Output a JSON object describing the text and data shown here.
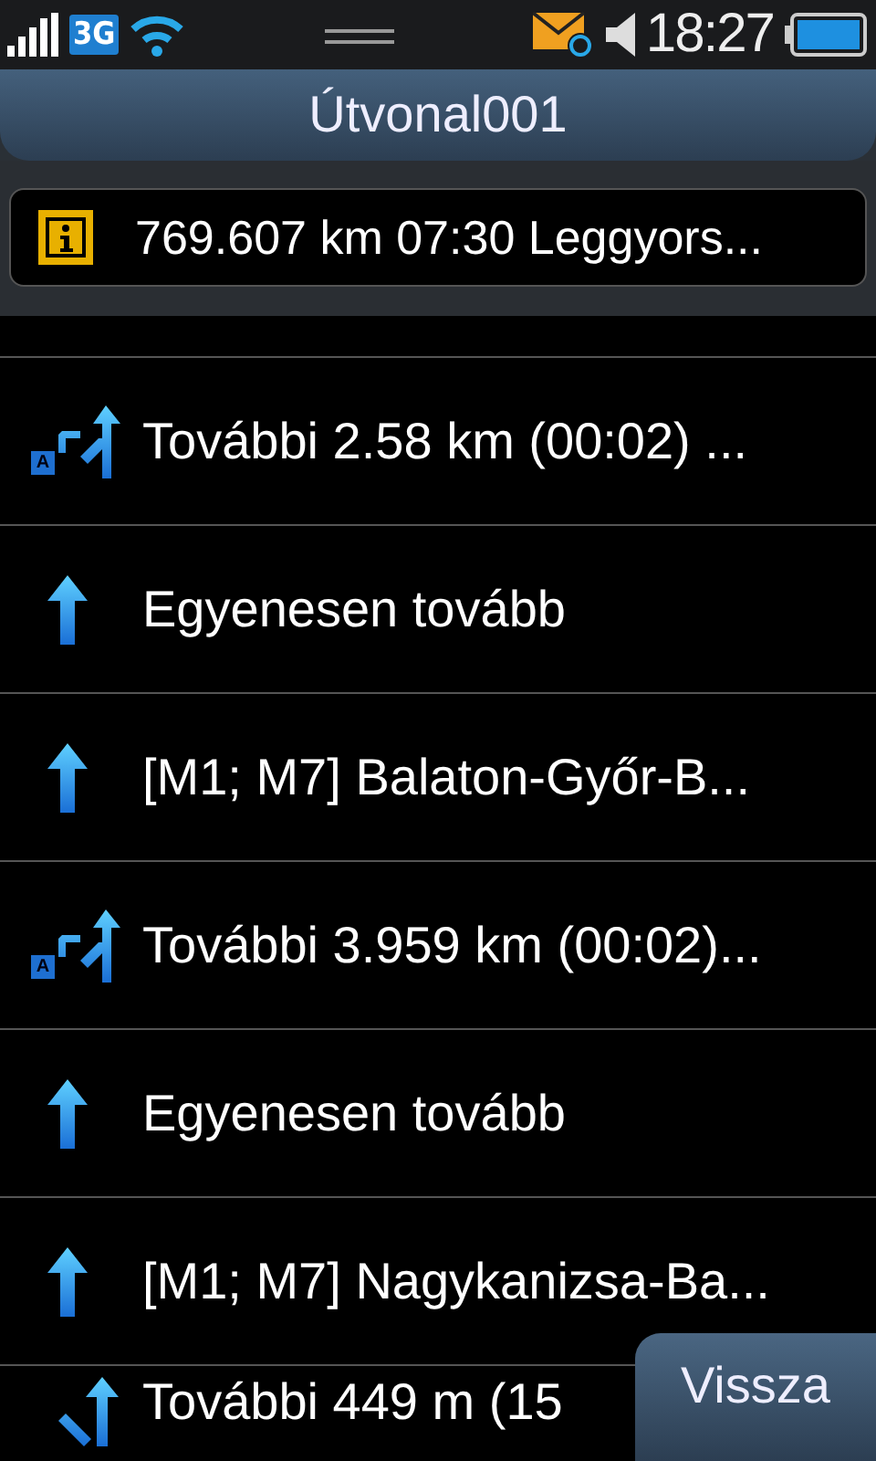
{
  "status_bar": {
    "network_type": "3G",
    "time": "18:27"
  },
  "title": "Útvonal001",
  "summary": "769.607 km 07:30 Leggyors...",
  "steps": [
    {
      "kind": "blank"
    },
    {
      "kind": "keep",
      "badge": "A",
      "text": "További 2.58 km (00:02) ..."
    },
    {
      "kind": "straight",
      "text": "Egyenesen tovább"
    },
    {
      "kind": "straight",
      "text": "[M1; M7] Balaton-Győr-B..."
    },
    {
      "kind": "keep",
      "badge": "A",
      "text": "További 3.959 km (00:02)..."
    },
    {
      "kind": "straight",
      "text": "Egyenesen tovább"
    },
    {
      "kind": "straight",
      "text": "[M1; M7] Nagykanizsa-Ba..."
    },
    {
      "kind": "turn",
      "text": "További 449 m (15"
    }
  ],
  "back_button": "Vissza"
}
